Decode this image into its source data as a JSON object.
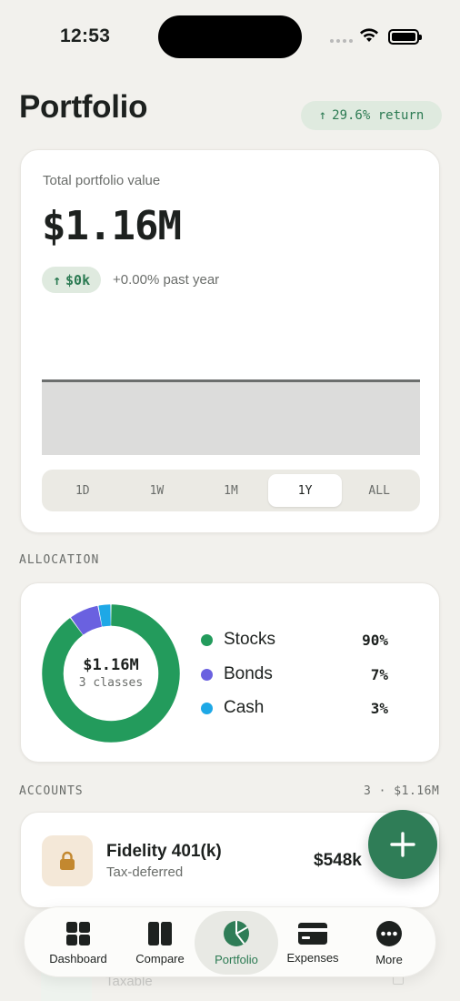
{
  "status": {
    "time": "12:53"
  },
  "header": {
    "title": "Portfolio",
    "return_arrow": "↑",
    "return_text": "29.6% return"
  },
  "summary": {
    "label": "Total portfolio value",
    "value": "$1.16M",
    "change_arrow": "↑",
    "change_amount": "$0k",
    "change_sub": "+0.00% past year",
    "ranges": [
      "1D",
      "1W",
      "1M",
      "1Y",
      "ALL"
    ],
    "selected_range": "1Y"
  },
  "allocation": {
    "section_label": "ALLOCATION",
    "center_value": "$1.16M",
    "center_sub": "3 classes",
    "items": [
      {
        "name": "Stocks",
        "percent": "90%",
        "share": 0.9,
        "color": "#239b5c"
      },
      {
        "name": "Bonds",
        "percent": "7%",
        "share": 0.07,
        "color": "#6a61e0"
      },
      {
        "name": "Cash",
        "percent": "3%",
        "share": 0.03,
        "color": "#1ea8e6"
      }
    ]
  },
  "accounts": {
    "section_label": "ACCOUNTS",
    "summary": "3 · $1.16M",
    "items": [
      {
        "name": "Fidelity 401(k)",
        "type": "Tax-deferred",
        "amount": "$548k",
        "icon": "lock-icon"
      }
    ],
    "partial_next_type": "Taxable"
  },
  "tabs": [
    {
      "label": "Dashboard",
      "icon": "dashboard-icon"
    },
    {
      "label": "Compare",
      "icon": "compare-icon"
    },
    {
      "label": "Portfolio",
      "icon": "pie-chart-icon"
    },
    {
      "label": "Expenses",
      "icon": "credit-card-icon"
    },
    {
      "label": "More",
      "icon": "more-icon"
    }
  ],
  "active_tab": "Portfolio",
  "colors": {
    "accent": "#2f7d57",
    "background": "#f2f1ed",
    "positive_bg": "#dfeadf"
  }
}
